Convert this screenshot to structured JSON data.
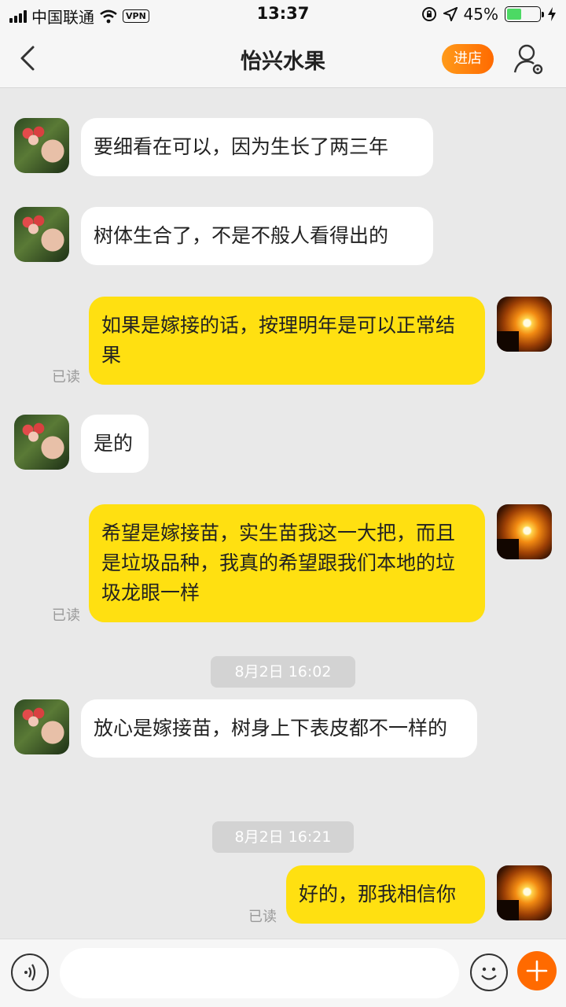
{
  "status_bar": {
    "carrier": "中国联通",
    "vpn": "VPN",
    "time": "13:37",
    "battery": "45%",
    "battery_level": 0.45
  },
  "header": {
    "title": "怡兴水果",
    "store_button": "进店"
  },
  "messages": [
    {
      "from": "seller",
      "text": "要细看在可以，因为生长了两三年"
    },
    {
      "from": "seller",
      "text": "树体生合了，不是不般人看得出的"
    },
    {
      "from": "me",
      "text": "如果是嫁接的话，按理明年是可以正常结果",
      "read": "已读"
    },
    {
      "from": "seller",
      "text": "是的"
    },
    {
      "from": "me",
      "text": "希望是嫁接苗，实生苗我这一大把，而且是垃圾品种，我真的希望跟我们本地的垃圾龙眼一样",
      "read": "已读"
    },
    {
      "timestamp": "8月2日 16:02"
    },
    {
      "from": "seller",
      "text": "放心是嫁接苗，树身上下表皮都不一样的"
    },
    {
      "timestamp": "8月2日 16:21"
    },
    {
      "from": "me",
      "text": "好的，那我相信你",
      "read": "已读"
    }
  ],
  "input": {
    "placeholder": ""
  },
  "colors": {
    "accent": "#ff6a00",
    "outgoing_bubble": "#ffe011",
    "incoming_bubble": "#ffffff"
  }
}
